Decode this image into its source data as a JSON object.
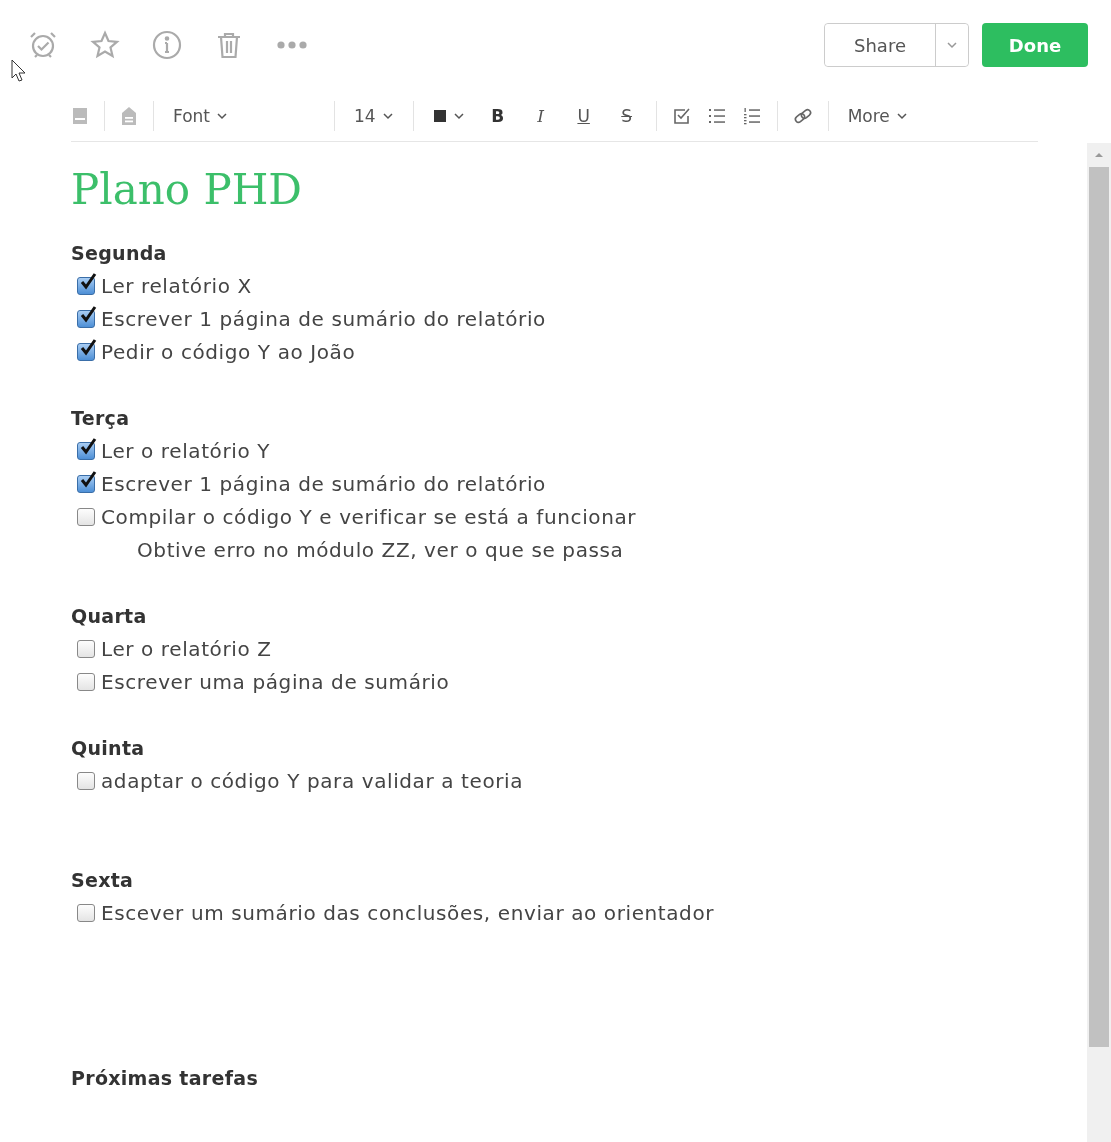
{
  "top_bar": {
    "share": "Share",
    "done": "Done"
  },
  "format_toolbar": {
    "font": "Font",
    "size": "14",
    "formats": [
      {
        "kind": "bold",
        "label": "B"
      },
      {
        "kind": "italic",
        "label": "I"
      },
      {
        "kind": "underline",
        "label": "U"
      },
      {
        "kind": "strike",
        "label": "S"
      }
    ],
    "more": "More"
  },
  "note": {
    "title": "Plano PHD",
    "blocks": [
      {
        "kind": "heading",
        "text": "Segunda"
      },
      {
        "kind": "task",
        "text": "Ler relatório X",
        "checked": true
      },
      {
        "kind": "task",
        "text": "Escrever 1 página de sumário do relatório",
        "checked": true
      },
      {
        "kind": "task",
        "text": "Pedir o código Y ao João",
        "checked": true
      },
      {
        "kind": "gap"
      },
      {
        "kind": "heading",
        "text": "Terça"
      },
      {
        "kind": "task",
        "text": "Ler o relatório Y",
        "checked": true
      },
      {
        "kind": "task",
        "text": "Escrever 1 página de sumário do relatório",
        "checked": true
      },
      {
        "kind": "task",
        "text": "Compilar o código Y e verificar se está a funcionar",
        "checked": false
      },
      {
        "kind": "note",
        "text": "Obtive erro no módulo ZZ, ver o que se passa"
      },
      {
        "kind": "gap"
      },
      {
        "kind": "heading",
        "text": "Quarta"
      },
      {
        "kind": "task",
        "text": "Ler o relatório Z",
        "checked": false
      },
      {
        "kind": "task",
        "text": "Escrever uma página de sumário",
        "checked": false
      },
      {
        "kind": "gap"
      },
      {
        "kind": "heading",
        "text": "Quinta"
      },
      {
        "kind": "task",
        "text": "adaptar o código Y para validar a teoria",
        "checked": false
      },
      {
        "kind": "gap"
      },
      {
        "kind": "gap"
      },
      {
        "kind": "heading",
        "text": "Sexta"
      },
      {
        "kind": "task",
        "text": "Escever um sumário das conclusões, enviar ao orientador",
        "checked": false
      },
      {
        "kind": "gap"
      },
      {
        "kind": "gap"
      },
      {
        "kind": "gap"
      },
      {
        "kind": "gap"
      },
      {
        "kind": "heading",
        "text": "Próximas tarefas"
      }
    ]
  }
}
